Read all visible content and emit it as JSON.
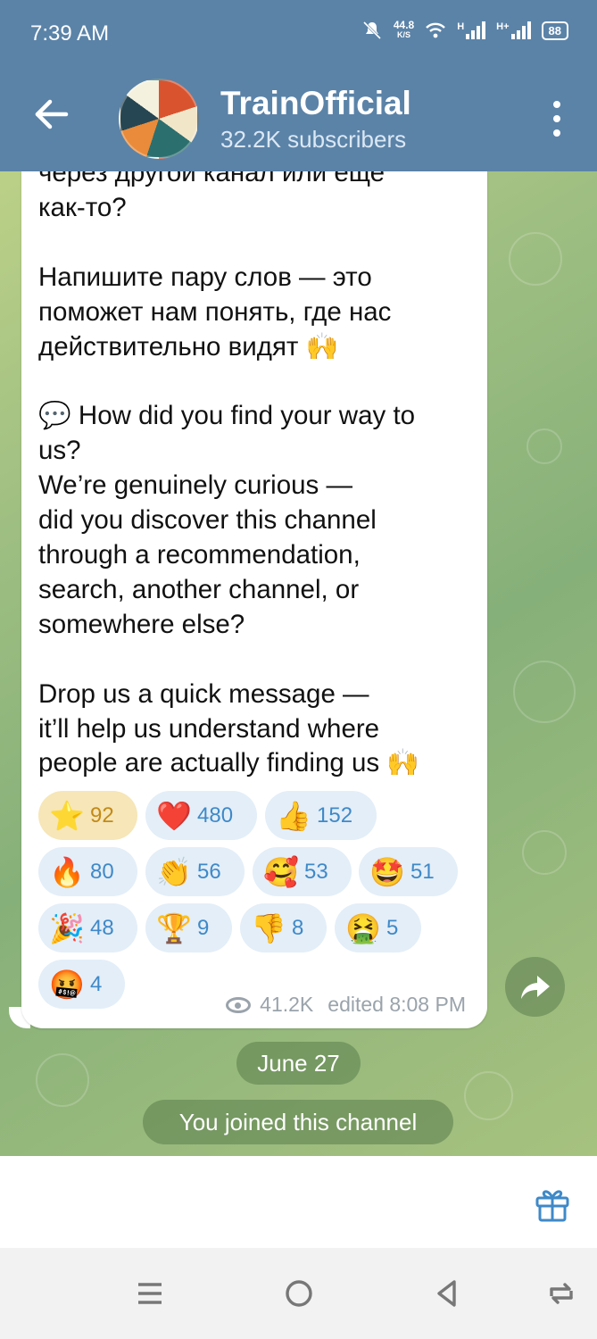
{
  "status_bar": {
    "time": "7:39 AM",
    "net_speed_value": "44.8",
    "net_speed_unit": "K/S",
    "signal1_label": "H",
    "signal2_label": "H+",
    "battery": "88"
  },
  "header": {
    "title": "TrainOfficial",
    "subtitle": "32.2K subscribers"
  },
  "message": {
    "text": "через другой канал или еще\nкак-то?\n\nНапишите пару слов — это\nпоможет нам понять, где нас\nдействительно видят 🙌\n\n💬 How did you find your way to\nus?\nWe’re genuinely curious —\ndid you discover this channel\nthrough a recommendation,\nsearch, another channel, or\nsomewhere else?\n\nDrop us a quick message —\nit’ll help us understand where\npeople are actually finding us 🙌",
    "reactions": [
      {
        "emoji": "⭐",
        "count": "92",
        "selected": true
      },
      {
        "emoji": "❤️",
        "count": "480"
      },
      {
        "emoji": "👍",
        "count": "152"
      },
      {
        "emoji": "🔥",
        "count": "80"
      },
      {
        "emoji": "👏",
        "count": "56"
      },
      {
        "emoji": "🥰",
        "count": "53"
      },
      {
        "emoji": "🤩",
        "count": "51"
      },
      {
        "emoji": "🎉",
        "count": "48"
      },
      {
        "emoji": "🏆",
        "count": "9"
      },
      {
        "emoji": "👎",
        "count": "8"
      },
      {
        "emoji": "🤮",
        "count": "5"
      },
      {
        "emoji": "🤬",
        "count": "4"
      }
    ],
    "views": "41.2K",
    "edited_label": "edited 8:08 PM"
  },
  "date_separator": "June 27",
  "service_message": "You joined this channel",
  "colors": {
    "header_bg": "#5b83a8",
    "accent": "#3f89c8",
    "selected_reaction_bg": "#f6e6b8"
  }
}
